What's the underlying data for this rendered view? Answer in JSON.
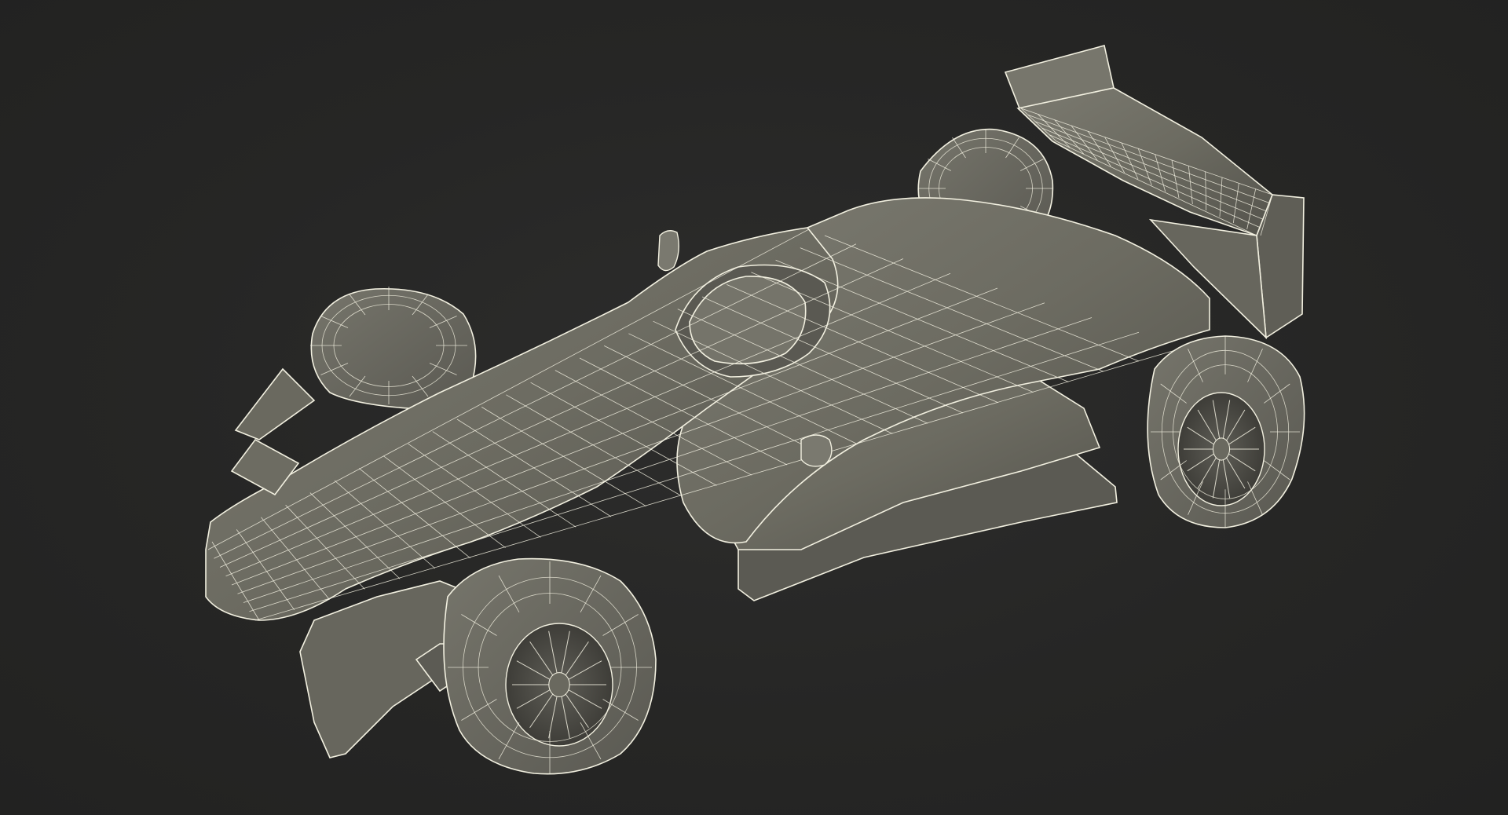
{
  "scene": {
    "subject": "formula-race-car-wireframe",
    "view": "top-perspective",
    "background_color": "#272726",
    "surface_color": "#6c6b61",
    "surface_shadow_color": "#4e4d46",
    "surface_highlight_color": "#85847a",
    "wire_color": "#f2f0e0",
    "parts": [
      "front-wing",
      "nose-cone",
      "cockpit",
      "driver-helmet",
      "engine-cover",
      "rear-wing",
      "front-left-wheel",
      "front-right-wheel",
      "rear-left-wheel",
      "rear-right-wheel",
      "sidepod-left",
      "sidepod-right",
      "floor",
      "mirrors",
      "suspension"
    ]
  }
}
